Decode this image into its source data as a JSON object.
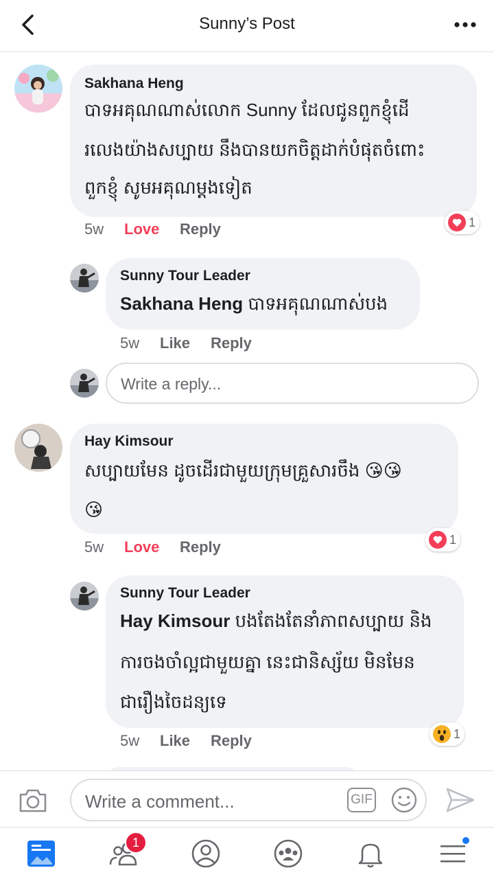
{
  "header": {
    "title": "Sunny’s Post"
  },
  "colors": {
    "love": "#f33e58",
    "bubble": "#f0f2f5",
    "accent": "#1877f2",
    "badge": "#e41e3f"
  },
  "comments": [
    {
      "author": "Sakhana Heng",
      "lines": [
        "បាទអគុណណាស់លោក Sunny ដែលជូនពួកខ្ញុំដើ",
        "រលេងយ៉ាងសប្បាយ នឹងបានយកចិត្តដាក់បំផុតចំពោះ",
        "ពួកខ្ញុំ សូមអគុណម្តងទៀត"
      ],
      "time": "5w",
      "like_label": "Love",
      "reply_label": "Reply",
      "reaction_icon": "heart-icon",
      "reaction_count": "1"
    },
    {
      "author": "Sunny Tour Leader",
      "mention": "Sakhana Heng",
      "lines": [
        "បាទអគុណណាស់បង"
      ],
      "time": "5w",
      "like_label": "Like",
      "reply_label": "Reply"
    },
    {
      "author": "Hay Kimsour",
      "lines": [
        "សប្បាយមែន ដូចដើរជាមួយក្រុមគ្រួសារចឹង"
      ],
      "emojis": [
        "😘",
        "😘",
        "😘"
      ],
      "time": "5w",
      "like_label": "Love",
      "reply_label": "Reply",
      "reaction_icon": "heart-icon",
      "reaction_count": "1"
    },
    {
      "author": "Sunny Tour Leader",
      "mention": "Hay Kimsour",
      "lines": [
        "បងតែងតែនាំភាពសប្បាយ និង",
        "ការចងចាំល្អជាមួយគ្នា នេះជានិស្ស័យ មិនមែន",
        "ជារឿងចៃដន្យទេ"
      ],
      "time": "5w",
      "like_label": "Like",
      "reply_label": "Reply",
      "reaction_icon": "wow-icon",
      "reaction_count": "1"
    }
  ],
  "reply_box": {
    "placeholder": "Write a reply..."
  },
  "composer": {
    "placeholder": "Write a comment...",
    "gif_label": "GIF"
  },
  "tabbar": {
    "items": [
      "news-feed-icon",
      "friends-icon",
      "profile-icon",
      "groups-icon",
      "notifications-icon",
      "menu-icon"
    ],
    "friends_badge": "1"
  }
}
